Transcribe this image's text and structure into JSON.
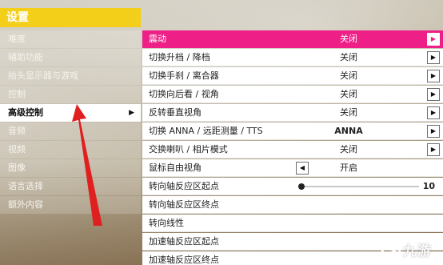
{
  "menu": {
    "title": "设置",
    "items": [
      {
        "label": "难度"
      },
      {
        "label": "辅助功能"
      },
      {
        "label": "抬头显示器与游戏"
      },
      {
        "label": "控制"
      },
      {
        "label": "高级控制",
        "active": true
      },
      {
        "label": "音频"
      },
      {
        "label": "视频"
      },
      {
        "label": "图像"
      },
      {
        "label": "语言选择"
      },
      {
        "label": "额外内容"
      }
    ]
  },
  "settings": {
    "rows": [
      {
        "label": "震动",
        "value": "关闭"
      },
      {
        "label": "切换升档 / 降档",
        "value": "关闭"
      },
      {
        "label": "切换手刹 / 离合器",
        "value": "关闭"
      },
      {
        "label": "切换向后看 / 视角",
        "value": "关闭"
      },
      {
        "label": "反转垂直视角",
        "value": "关闭"
      },
      {
        "label": "切换 ANNA / 远距测量 / TTS",
        "value": "ANNA"
      },
      {
        "label": "交换喇叭 / 相片模式",
        "value": "关闭"
      },
      {
        "label": "鼠标自由视角",
        "value": "开启"
      },
      {
        "label": "转向轴反应区起点",
        "value": "10"
      },
      {
        "label": "转向轴反应区终点"
      },
      {
        "label": "转向线性"
      },
      {
        "label": "加速轴反应区起点"
      },
      {
        "label": "加速轴反应区终点"
      }
    ],
    "slider_level_fraction": 0.02
  },
  "icons": {
    "next": "play-right-icon",
    "prev": "play-left-icon",
    "menu_arrow": "play-right-icon"
  },
  "colors": {
    "title_bar": "#f3cf1a",
    "highlight_row": "#ee1f86",
    "annotation_arrow": "#e02020"
  },
  "watermark": {
    "text": "九游"
  }
}
